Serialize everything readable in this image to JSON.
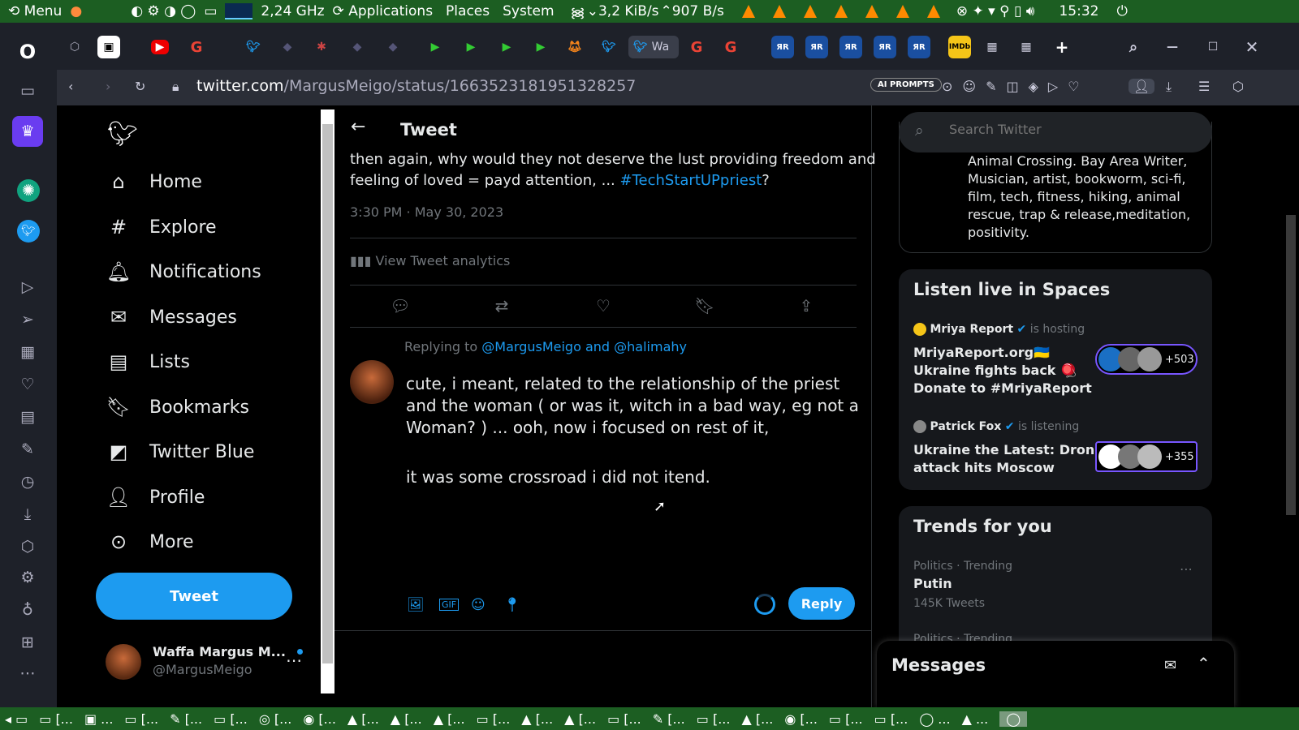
{
  "system": {
    "menu_label": "Menu",
    "cpu": "2,24 GHz",
    "applications": "Applications",
    "places": "Places",
    "system_menu": "System",
    "download_speed": "3,2 KiB/s",
    "upload_speed": "907 B/s",
    "clock": "15:32"
  },
  "browser": {
    "active_tab_label": "Wa",
    "url_host": "twitter.com",
    "url_path": "/MargusMeigo/status/1663523181951328257",
    "ai_prompts": "AI PROMPTS"
  },
  "nav": {
    "items": [
      {
        "label": "Home",
        "icon": "home-icon"
      },
      {
        "label": "Explore",
        "icon": "hashtag-icon"
      },
      {
        "label": "Notifications",
        "icon": "bell-icon"
      },
      {
        "label": "Messages",
        "icon": "mail-icon"
      },
      {
        "label": "Lists",
        "icon": "list-icon"
      },
      {
        "label": "Bookmarks",
        "icon": "bookmark-icon"
      },
      {
        "label": "Twitter Blue",
        "icon": "twitter-blue-icon"
      },
      {
        "label": "Profile",
        "icon": "person-icon"
      },
      {
        "label": "More",
        "icon": "more-circle-icon"
      }
    ],
    "tweet_button": "Tweet",
    "account_name": "Waffa Margus M...",
    "account_handle": "@MargusMeigo"
  },
  "tweet": {
    "header": "Tweet",
    "text_line1": "then again, why would they not deserve the lust providing freedom and",
    "text_line2": "feeling of loved = payd attention, ...",
    "hashtag": "#TechStartUPpriest",
    "text_end": "?",
    "timestamp": "3:30 PM · May 30, 2023",
    "analytics": "View Tweet analytics"
  },
  "reply": {
    "replying_to_label": "Replying to",
    "replying_to_users": "@MargusMeigo and @halimahy",
    "line1": "cute, i meant, related to the relationship of the priest",
    "line2": "and the woman ( or was it, witch in a bad way, eg not a",
    "line3": "Woman? ) ... ooh, now i focused on rest of it,",
    "line4": "it was some crossroad i did not itend.",
    "reply_button": "Reply"
  },
  "search": {
    "placeholder": "Search Twitter"
  },
  "bio": {
    "lines": [
      "Animal Crossing. Bay Area Writer,",
      "Musician, artist, bookworm, sci-fi,",
      "film, tech, fitness, hiking, animal",
      "rescue, trap & release,meditation,",
      "positivity."
    ]
  },
  "spaces": {
    "title": "Listen live in Spaces",
    "items": [
      {
        "host": "Mriya Report",
        "status": "is hosting",
        "title_lines": [
          "MriyaReport.org🇺🇦",
          "Ukraine fights back 🪀",
          "Donate to #MriyaReport"
        ],
        "count": "+503"
      },
      {
        "host": "Patrick Fox",
        "status": "is listening",
        "title_lines": [
          "Ukraine the Latest: Drone",
          "attack hits Moscow"
        ],
        "count": "+355"
      }
    ]
  },
  "trends": {
    "title": "Trends for you",
    "items": [
      {
        "context": "Politics · Trending",
        "name": "Putin",
        "count": "145K Tweets"
      },
      {
        "context": "Politics · Trending",
        "name": "",
        "count": ""
      }
    ]
  },
  "messages_panel": {
    "title": "Messages"
  },
  "colors": {
    "accent": "#1d9bf0",
    "panel_green": "#1c5e22",
    "card_bg": "#16181c"
  }
}
